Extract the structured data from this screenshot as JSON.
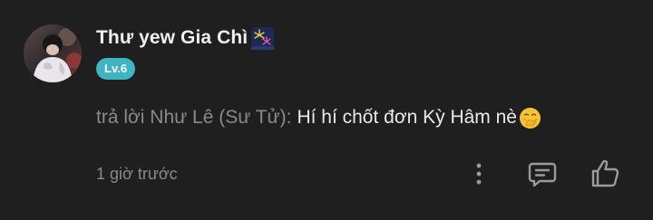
{
  "comment": {
    "username": "Thư yew Gia Chì",
    "username_icon": "fireworks-emoji-icon",
    "level": "Lv.6",
    "level_color": "#3fb5c4",
    "reply_prefix": "trả lời Như Lê (Sư Tử):",
    "reply_text": "Hí hí chốt đơn Kỳ Hâm nè",
    "reply_emoji": "face-with-hand-over-mouth-emoji-icon",
    "timestamp": "1 giờ trước"
  },
  "actions": {
    "more_icon": "vertical-ellipsis-icon",
    "reply_icon": "comment-bubble-icon",
    "like_icon": "thumbs-up-icon"
  }
}
